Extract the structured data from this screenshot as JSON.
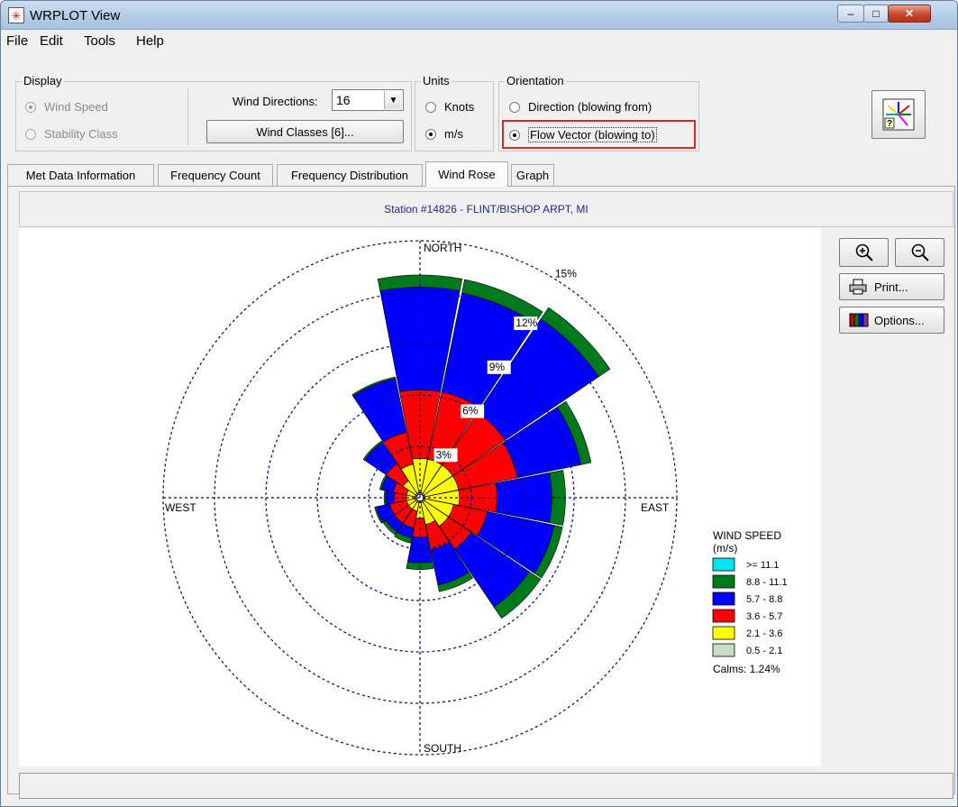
{
  "window": {
    "title": "WRPLOT View",
    "min_glyph": "–",
    "max_glyph": "□",
    "close_glyph": "✕"
  },
  "menu": {
    "items": [
      "File",
      "Edit",
      "Tools",
      "Help"
    ]
  },
  "display_group": {
    "label": "Display",
    "options": [
      {
        "label": "Wind Speed",
        "selected": true,
        "enabled": false
      },
      {
        "label": "Stability Class",
        "selected": false,
        "enabled": false
      }
    ],
    "wind_directions_label": "Wind Directions:",
    "wind_directions_value": "16",
    "wind_classes_button": "Wind Classes [6]..."
  },
  "units_group": {
    "label": "Units",
    "options": [
      {
        "label": "Knots",
        "selected": false
      },
      {
        "label": "m/s",
        "selected": true
      }
    ]
  },
  "orientation_group": {
    "label": "Orientation",
    "options": [
      {
        "label": "Direction (blowing from)",
        "selected": false
      },
      {
        "label": "Flow Vector (blowing to)",
        "selected": true
      }
    ]
  },
  "tabs": [
    {
      "label": "Met Data Information",
      "active": false
    },
    {
      "label": "Frequency Count",
      "active": false
    },
    {
      "label": "Frequency Distribution",
      "active": false
    },
    {
      "label": "Wind Rose",
      "active": true
    },
    {
      "label": "Graph",
      "active": false
    }
  ],
  "station": "Station #14826 - FLINT/BISHOP ARPT, MI",
  "side_buttons": {
    "zoom_in_icon": "zoom-in-icon",
    "zoom_out_icon": "zoom-out-icon",
    "print_label": "Print...",
    "options_label": "Options..."
  },
  "status_text": "",
  "chart_data": {
    "type": "wind-rose",
    "compass_labels": {
      "north": "NORTH",
      "south": "SOUTH",
      "east": "EAST",
      "west": "WEST"
    },
    "ring_labels": [
      "3%",
      "6%",
      "9%",
      "12%",
      "15%"
    ],
    "ring_values": [
      3,
      6,
      9,
      12,
      15
    ],
    "directions": [
      "N",
      "NNE",
      "NE",
      "ENE",
      "E",
      "ESE",
      "SE",
      "SSE",
      "S",
      "SSW",
      "SW",
      "WSW",
      "W",
      "WNW",
      "NW",
      "NNW"
    ],
    "legend": {
      "title_line1": "WIND SPEED",
      "title_line2": "(m/s)",
      "classes": [
        {
          "label": ">= 11.1",
          "color": "#00e5ee"
        },
        {
          "label": "8.8 - 11.1",
          "color": "#007a1c"
        },
        {
          "label": "5.7 -  8.8",
          "color": "#0000ff"
        },
        {
          "label": "3.6 -  5.7",
          "color": "#ff0000"
        },
        {
          "label": "2.1 -  3.6",
          "color": "#ffff00"
        },
        {
          "label": "0.5 -  2.1",
          "color": "#c8dcc8"
        }
      ],
      "calms": "Calms: 1.24%"
    },
    "series_cumulative_percent": [
      [
        0.3,
        2.3,
        6.3,
        12.3,
        13.0,
        13.0
      ],
      [
        0.3,
        2.3,
        6.3,
        12.2,
        13.0,
        13.0
      ],
      [
        0.3,
        2.3,
        6.0,
        12.6,
        13.4,
        13.4
      ],
      [
        0.3,
        2.3,
        5.8,
        9.6,
        10.2,
        10.2
      ],
      [
        0.3,
        2.3,
        4.5,
        7.7,
        8.5,
        8.5
      ],
      [
        0.3,
        2.0,
        4.0,
        8.0,
        8.5,
        8.5
      ],
      [
        0.3,
        2.0,
        3.6,
        7.7,
        8.5,
        8.5
      ],
      [
        0.3,
        1.6,
        3.1,
        5.2,
        5.6,
        5.6
      ],
      [
        0.3,
        1.2,
        2.3,
        3.8,
        4.2,
        4.2
      ],
      [
        0.3,
        0.8,
        1.8,
        2.4,
        2.7,
        2.7
      ],
      [
        0.3,
        0.8,
        1.8,
        2.4,
        2.6,
        2.6
      ],
      [
        0.3,
        0.8,
        1.8,
        2.6,
        2.7,
        2.7
      ],
      [
        0.3,
        0.8,
        1.5,
        2.0,
        2.1,
        2.1
      ],
      [
        0.3,
        0.8,
        1.6,
        2.3,
        2.4,
        2.4
      ],
      [
        0.3,
        1.2,
        2.4,
        3.9,
        4.0,
        4.0
      ],
      [
        0.3,
        2.0,
        3.9,
        7.1,
        7.2,
        7.2
      ]
    ]
  }
}
